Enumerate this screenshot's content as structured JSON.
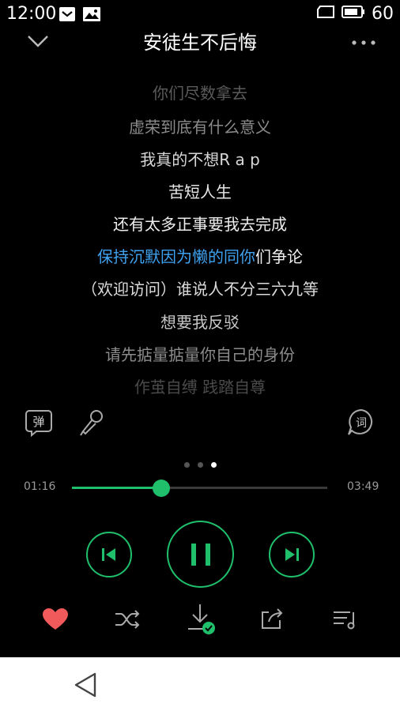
{
  "status": {
    "time": "12:00",
    "battery_text": "60"
  },
  "header": {
    "title": "安徒生不后悔"
  },
  "lyrics": [
    {
      "text": "你们尽数拿去",
      "color": "#5a5a5a"
    },
    {
      "text": "虚荣到底有什么意义",
      "color": "#8a8a8a"
    },
    {
      "text": "我真的不想R a p",
      "color": "#d8d8d8"
    },
    {
      "text": "苦短人生",
      "color": "#e8e8e8"
    },
    {
      "text": "还有太多正事要我去完成",
      "color": "#eeeeee"
    },
    {
      "hl": "保持沉默因为懒的同你",
      "rest": "们争论",
      "color": "#eeeeee",
      "hl_color": "#3fa2f0"
    },
    {
      "text": "（欢迎访问）谁说人不分三六九等",
      "color": "#dcdcdc"
    },
    {
      "text": "想要我反驳",
      "color": "#c8c8c8"
    },
    {
      "text": "请先掂量掂量你自己的身份",
      "color": "#8c8c8c"
    },
    {
      "text": "作茧自缚 践踏自尊",
      "color": "#4a4a4a"
    }
  ],
  "tools": {
    "danmu_label": "弹",
    "lyric_label": "词"
  },
  "pager": {
    "count": 3,
    "active": 2
  },
  "progress": {
    "current": "01:16",
    "total": "03:49",
    "fraction": 0.35
  },
  "colors": {
    "accent": "#1fbf6b",
    "heart": "#f05a5a",
    "lyric_highlight": "#3fa2f0"
  }
}
